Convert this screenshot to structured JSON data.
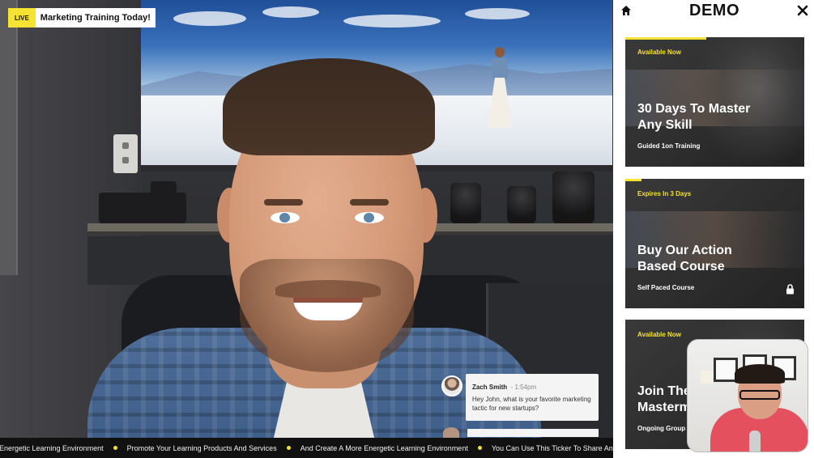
{
  "live_badge": {
    "tag": "LIVE",
    "title": "Marketing Training Today!"
  },
  "chat": {
    "name": "Zach Smith",
    "time": "- 1:54pm",
    "message": "Hey John, what is your favorite marketing tactic for new startups?"
  },
  "ticker": {
    "items": [
      "Energetic Learning Environment",
      "Promote Your Learning Products And Services",
      "And Create A More Energetic Learning Environment",
      "You Can Use This Ticker To Share Announcements"
    ]
  },
  "panel": {
    "brand": "DEMO",
    "home_icon": "home-icon",
    "close_icon": "close-icon",
    "cards": [
      {
        "badge": "Available Now",
        "title_line1": "30 Days To Master",
        "title_line2": "Any Skill",
        "subtitle": "Guided 1on Training"
      },
      {
        "badge": "Expires In 3 Days",
        "title_line1": "Buy Our Action",
        "title_line2": "Based Course",
        "subtitle": "Self Paced Course",
        "icon": "lock-icon"
      },
      {
        "badge": "Available Now",
        "title_line1": "Join The",
        "title_line2": "Mastermind",
        "subtitle": "Ongoing Group Training"
      }
    ]
  },
  "colors": {
    "accent": "#f6e232",
    "panel_bg": "#ffffff",
    "ticker_bg": "#111111"
  }
}
